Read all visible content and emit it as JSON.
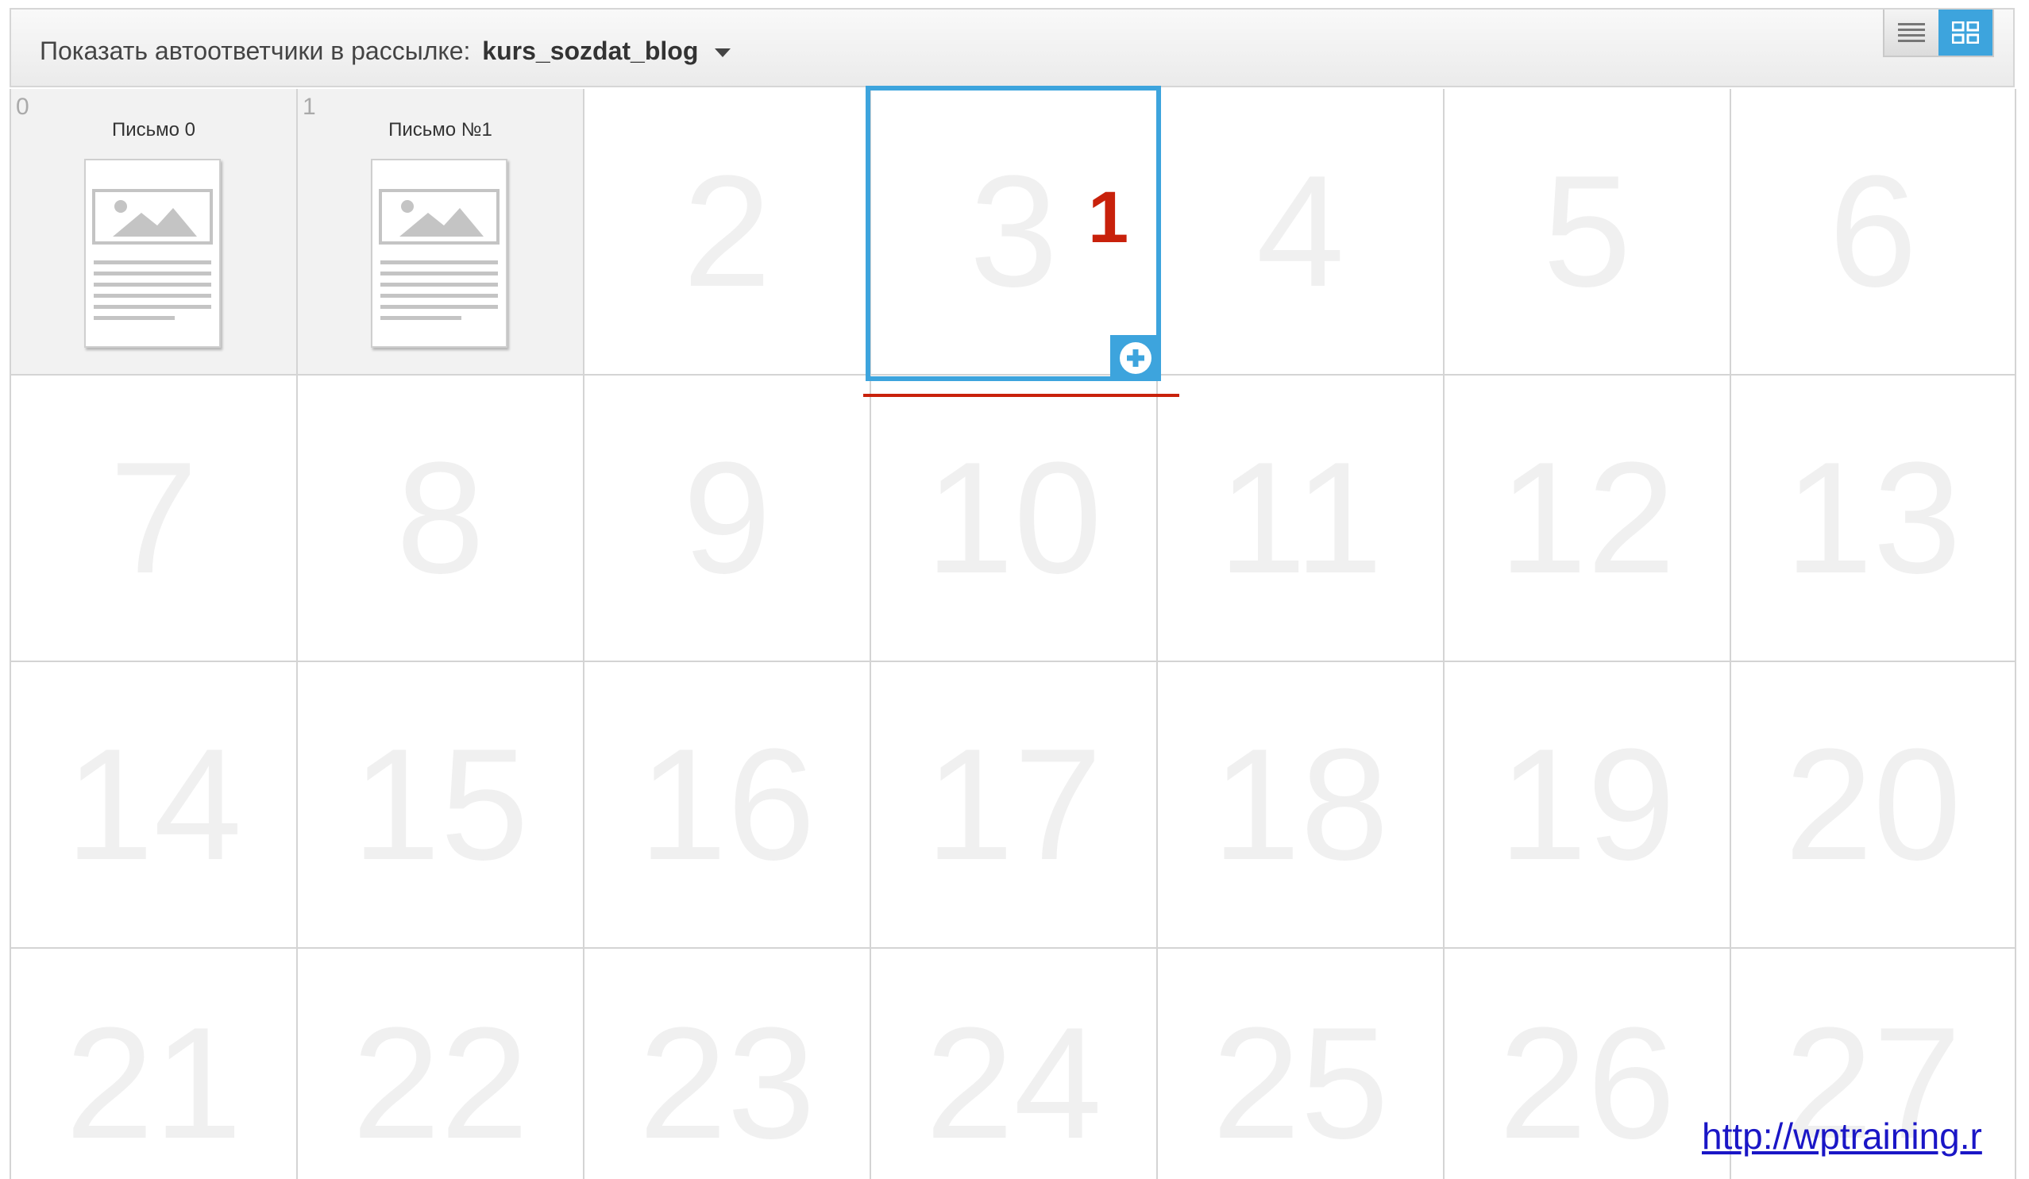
{
  "header": {
    "label": "Показать автоответчики в рассылке:",
    "list_name": "kurs_sozdat_blog",
    "accent_color": "#3da4dd"
  },
  "view_toggle": {
    "list_icon": "list-icon",
    "grid_icon": "grid-icon",
    "active": "grid"
  },
  "days": [
    "0",
    "1",
    "2",
    "3",
    "4",
    "5",
    "6",
    "7",
    "8",
    "9",
    "10",
    "11",
    "12",
    "13",
    "14",
    "15",
    "16",
    "17",
    "18",
    "19",
    "20",
    "21",
    "22",
    "23",
    "24",
    "25",
    "26",
    "27"
  ],
  "letters": [
    {
      "day": "0",
      "title": "Письмо 0"
    },
    {
      "day": "1",
      "title": "Письмо №1"
    }
  ],
  "selected": {
    "day": "3",
    "add_icon": "plus-circle-icon"
  },
  "annotation": {
    "callout": "1",
    "color": "#c8210b"
  },
  "footer": {
    "link": "http://wptraining.r"
  }
}
